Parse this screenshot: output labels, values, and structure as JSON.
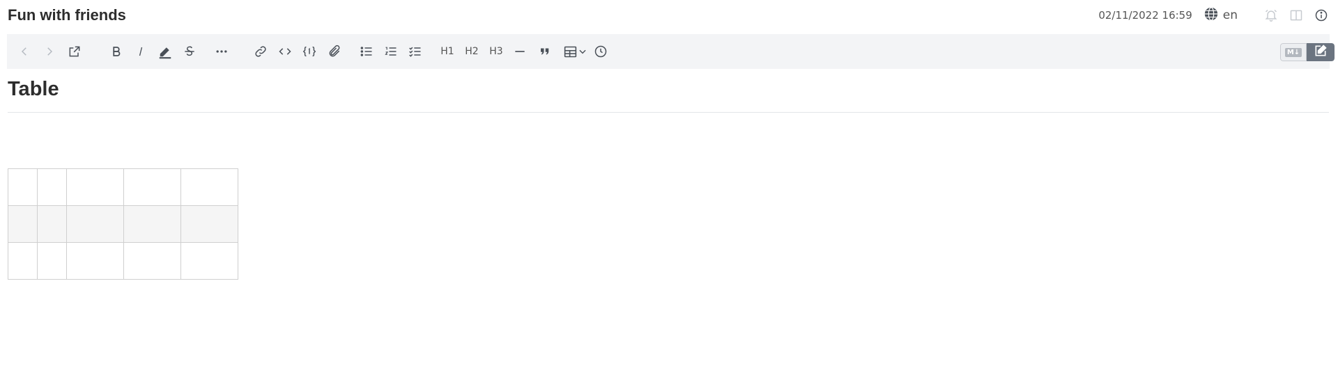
{
  "header": {
    "title": "Fun with friends",
    "timestamp": "02/11/2022 16:59",
    "language": "en",
    "icons": [
      "globe-icon",
      "bell-icon",
      "split-view-icon",
      "info-icon"
    ]
  },
  "toolbar": {
    "items": [
      "back-icon",
      "forward-icon",
      "open-external-icon",
      "bold-icon",
      "italic-icon",
      "highlight-icon",
      "strikethrough-icon",
      "more-icon",
      "link-icon",
      "code-icon",
      "code-block-icon",
      "attachment-icon",
      "bullet-list-icon",
      "numbered-list-icon",
      "checklist-icon",
      "horizontal-rule-icon",
      "quote-icon",
      "table-icon",
      "chevron-down-icon",
      "clock-icon"
    ],
    "h1": "H1",
    "h2": "H2",
    "h3": "H3",
    "mode_markdown": "M↓",
    "mode_editor_icon": "edit-icon"
  },
  "document": {
    "heading": "Table",
    "table": {
      "rows": 3,
      "columns": 5,
      "cells": [
        [
          "",
          "",
          "",
          "",
          ""
        ],
        [
          "",
          "",
          "",
          "",
          ""
        ],
        [
          "",
          "",
          "",
          "",
          ""
        ]
      ]
    }
  },
  "colors": {
    "toolbar_bg": "#f3f4f6",
    "active_mode": "#6b7480",
    "table_border": "#cfcfcf",
    "table_alt_row": "#f5f5f5"
  }
}
